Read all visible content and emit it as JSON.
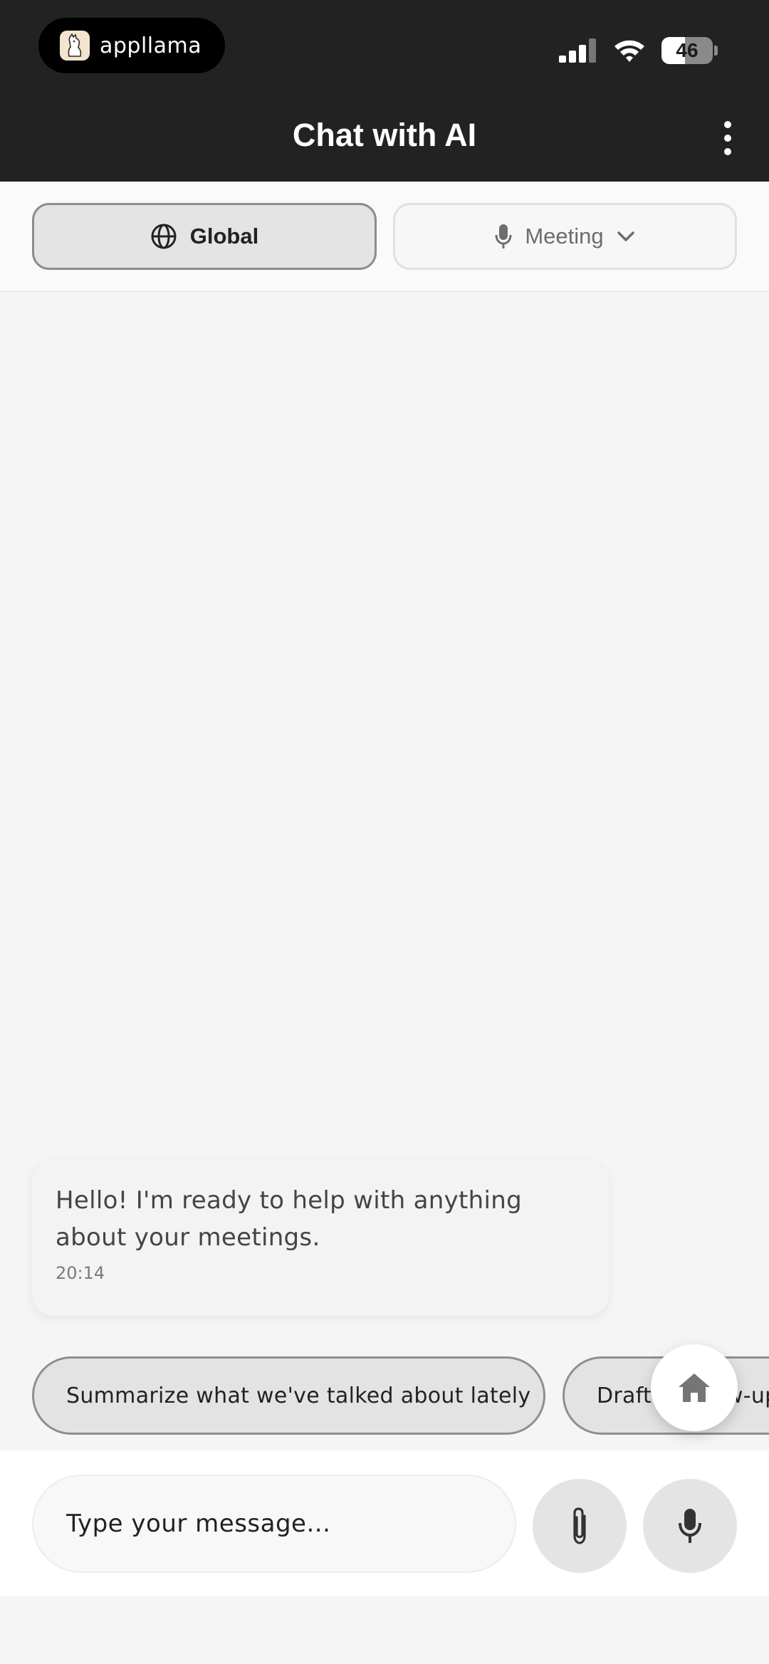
{
  "status_bar": {
    "app_name": "appllama",
    "battery": "46",
    "battery_level": 0.46
  },
  "header": {
    "title": "Chat with AI"
  },
  "modes": {
    "global_label": "Global",
    "meeting_label": "Meeting"
  },
  "messages": [
    {
      "text": "Hello! I'm ready to help with anything about your meetings.",
      "time": "20:14"
    }
  ],
  "suggestions": [
    "Summarize what we've talked about lately",
    "Draft a follow-up"
  ],
  "composer": {
    "placeholder": "Type your message..."
  },
  "icons": {
    "more": "more-vertical-icon",
    "globe": "globe-icon",
    "mic": "microphone-icon",
    "chevron": "chevron-down-icon",
    "home": "home-icon",
    "attach": "paperclip-icon"
  }
}
